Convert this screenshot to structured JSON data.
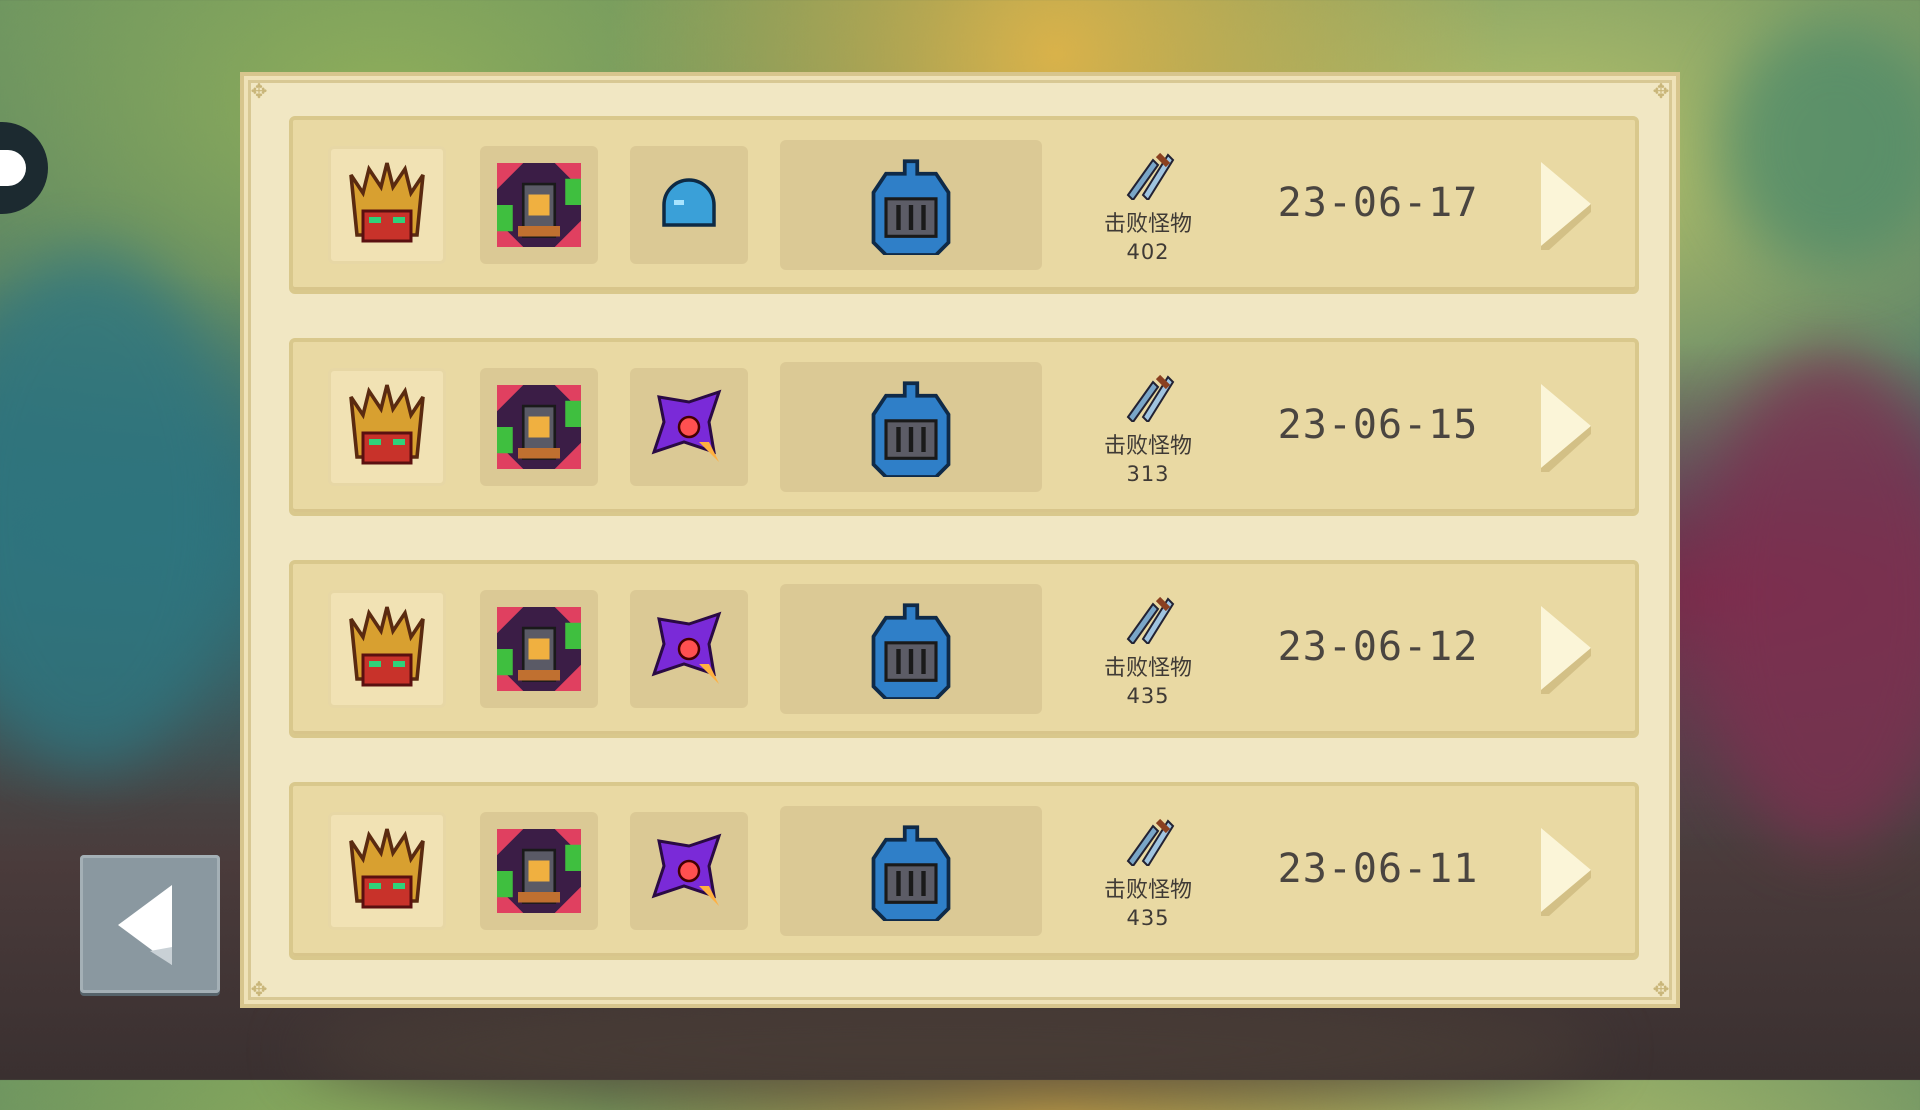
{
  "records": [
    {
      "date": "23-06-17",
      "kills_label": "击败怪物",
      "kills": "402",
      "slot3": "blue-slime-icon"
    },
    {
      "date": "23-06-15",
      "kills_label": "击败怪物",
      "kills": "313",
      "slot3": "purple-rocket-icon"
    },
    {
      "date": "23-06-12",
      "kills_label": "击败怪物",
      "kills": "435",
      "slot3": "purple-rocket-icon"
    },
    {
      "date": "23-06-11",
      "kills_label": "击败怪物",
      "kills": "435",
      "slot3": "purple-rocket-icon"
    }
  ],
  "icons": {
    "hero": "red-dragon-knight-icon",
    "slot2": "tower-skin-icon",
    "big": "knight-helmet-icon",
    "kills": "crossed-swords-icon"
  },
  "colors": {
    "panel": "#f1e7c3",
    "row": "#e9d9a3",
    "text": "#4a4540"
  }
}
